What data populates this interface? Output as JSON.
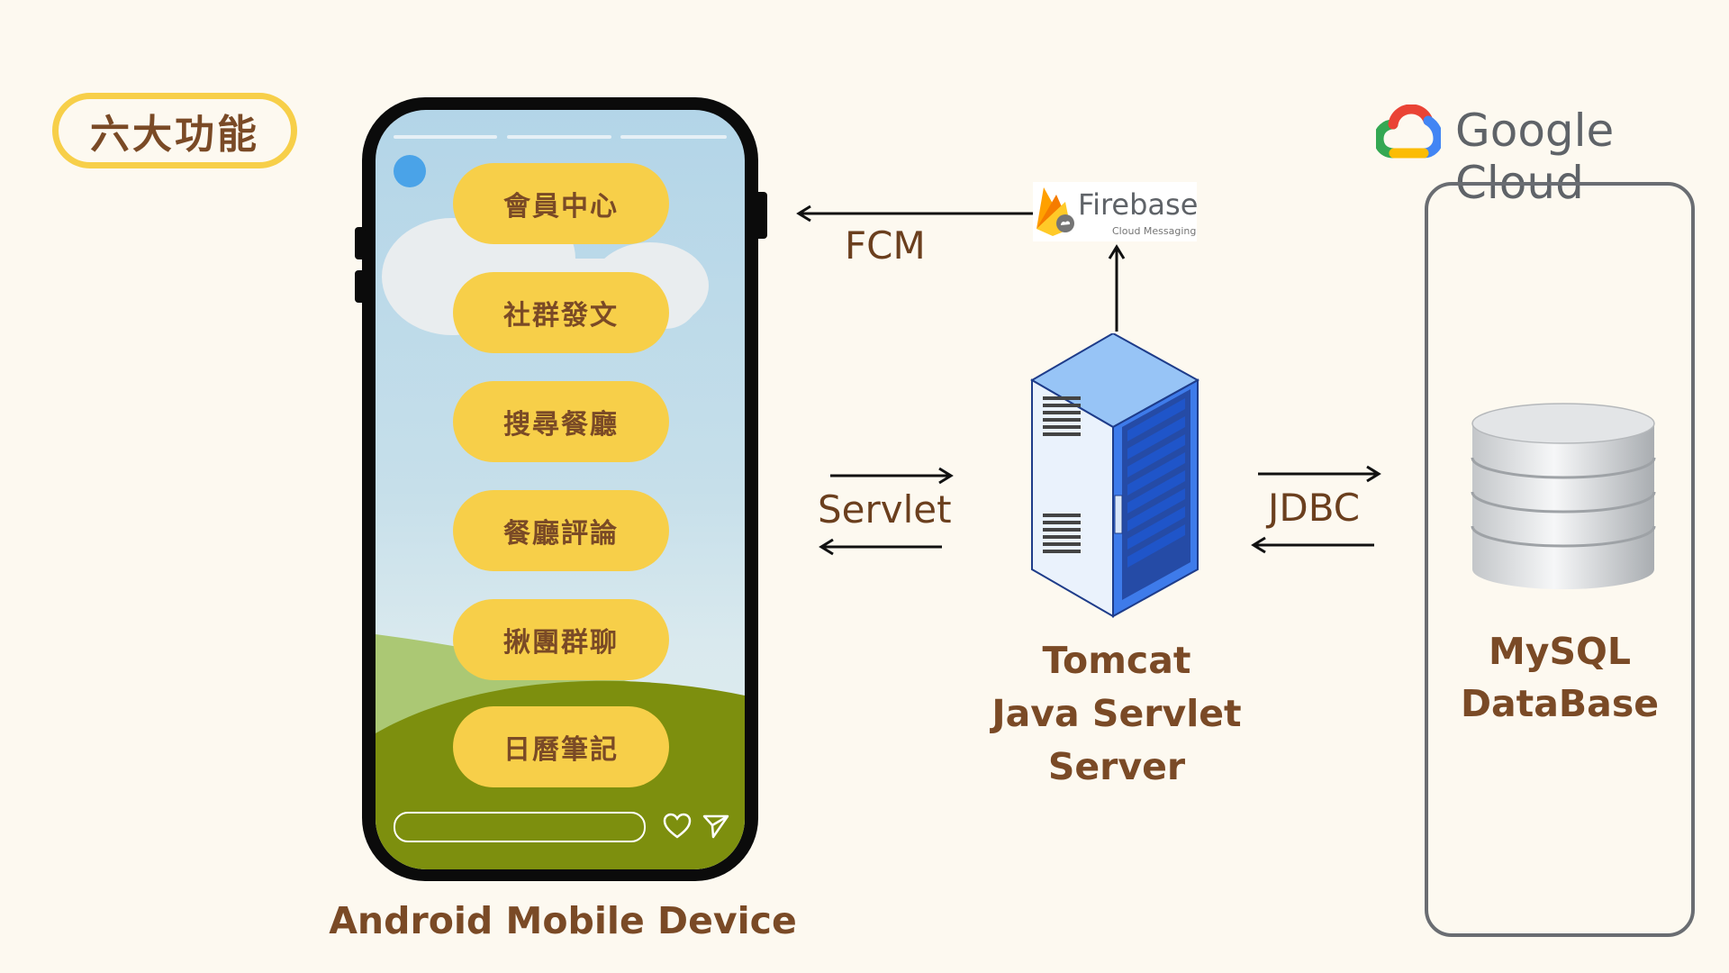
{
  "badge": {
    "label": "六大功能"
  },
  "phone": {
    "menu_items": [
      "會員中心",
      "社群發文",
      "搜尋餐廳",
      "餐廳評論",
      "揪團群聊",
      "日曆筆記"
    ],
    "caption": "Android Mobile Device"
  },
  "connections": {
    "fcm": "FCM",
    "servlet": "Servlet",
    "jdbc": "JDBC"
  },
  "firebase": {
    "name": "Firebase",
    "product": "Cloud Messaging"
  },
  "server": {
    "caption_lines": [
      "Tomcat",
      "Java Servlet",
      "Server"
    ]
  },
  "google_cloud": {
    "label": "Google Cloud"
  },
  "database": {
    "caption_lines": [
      "MySQL",
      "DataBase"
    ]
  },
  "colors": {
    "background": "#FDF9F0",
    "accent_yellow": "#F7CF49",
    "text_brown": "#7A4A26",
    "server_blue": "#3E7BEA"
  }
}
